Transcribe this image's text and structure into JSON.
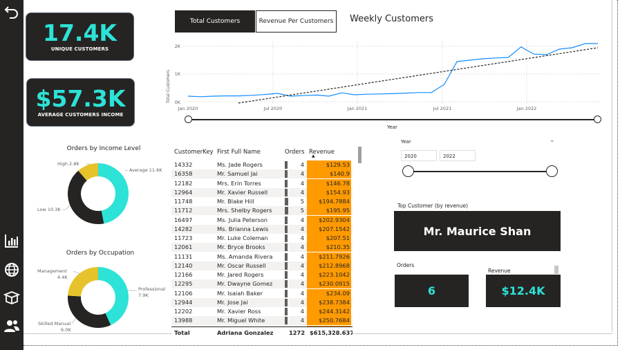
{
  "kpis": {
    "unique_customers": {
      "value": "17.4K",
      "label": "UNIQUE CUSTOMERS"
    },
    "avg_income": {
      "value": "$57.3K",
      "label": "AVERAGE CUSTOMERS INCOME"
    }
  },
  "tabs": {
    "total_customers": "Total Customers",
    "revenue_per_customer": "Revenue Per Customers"
  },
  "weekly": {
    "title": "Weekly Customers",
    "ylabel": "Total Customers",
    "xlabel": "Year",
    "yticks": [
      "2K",
      "1K",
      "0K"
    ],
    "xticks": [
      "Jan 2020",
      "Jul 2020",
      "Jan 2021",
      "Jul 2021",
      "Jan 2022"
    ]
  },
  "chart_data": [
    {
      "type": "line",
      "title": "Weekly Customers",
      "xlabel": "Year",
      "ylabel": "Total Customers",
      "x": [
        "2020-01",
        "2020-02",
        "2020-03",
        "2020-04",
        "2020-05",
        "2020-06",
        "2020-07",
        "2020-08",
        "2020-09",
        "2020-10",
        "2020-11",
        "2020-12",
        "2021-01",
        "2021-02",
        "2021-03",
        "2021-04",
        "2021-05",
        "2021-06",
        "2021-07",
        "2021-08",
        "2021-09",
        "2021-10",
        "2021-11",
        "2021-12",
        "2022-01",
        "2022-02",
        "2022-03",
        "2022-04",
        "2022-05",
        "2022-06"
      ],
      "series": [
        {
          "values": [
            200,
            180,
            200,
            210,
            210,
            230,
            260,
            300,
            200,
            220,
            240,
            200,
            320,
            250,
            270,
            280,
            290,
            310,
            330,
            330,
            620,
            1450,
            1500,
            1550,
            1580,
            1600,
            1980,
            1720,
            1700,
            1900,
            1950,
            2100,
            2100
          ]
        },
        {
          "values": [
            -50,
            30,
            110,
            190,
            270,
            350,
            430,
            510,
            590,
            670,
            750,
            830,
            910,
            990,
            1070,
            1150,
            1230,
            1310,
            1390,
            1470,
            1550,
            1630,
            1710,
            1790,
            1870,
            1950
          ]
        }
      ],
      "ylim": [
        0,
        2300
      ]
    },
    {
      "type": "pie",
      "title": "Orders by Income Level",
      "categories": [
        "Average",
        "Low",
        "High"
      ],
      "values": [
        11.6,
        10.3,
        2.8
      ],
      "labels": [
        "Average 11.6K",
        "Low 10.3K",
        "High 2.8K"
      ]
    },
    {
      "type": "pie",
      "title": "Orders by Occupation",
      "categories": [
        "Professional",
        "Skilled Manual",
        "Management"
      ],
      "values": [
        7.9,
        6.0,
        4.4
      ],
      "labels": [
        "Professional 7.9K",
        "Skilled Manual 6.0K",
        "Management 4.4K"
      ]
    }
  ],
  "donut_income": {
    "title": "Orders by Income Level",
    "avg": "Average 11.6K",
    "low": "Low 10.3K",
    "high": "High 2.8K"
  },
  "donut_occ": {
    "title": "Orders by Occupation",
    "prof_a": "Professional",
    "prof_b": "7.9K",
    "skill_a": "Skilled Manual",
    "skill_b": "6.0K",
    "mgmt_a": "Management",
    "mgmt_b": "4.4K"
  },
  "colors": {
    "teal": "#2de2d6",
    "dark": "#252423",
    "yellow": "#e6c22b",
    "orange": "#ff9a00"
  },
  "table": {
    "headers": [
      "CustomerKey",
      "First Full Name",
      "Orders",
      "Revenue"
    ],
    "rows": [
      [
        "14332",
        "Ms. Jade Rogers",
        "4",
        "$129.53"
      ],
      [
        "16358",
        "Mr. Samuel Jai",
        "4",
        "$140.9"
      ],
      [
        "12182",
        "Mrs. Erin Torres",
        "4",
        "$146.78"
      ],
      [
        "12964",
        "Mr. Xavier Russell",
        "4",
        "$154.93"
      ],
      [
        "11748",
        "Mr. Blake Hill",
        "5",
        "$194.7884"
      ],
      [
        "11712",
        "Mrs. Shelby Rogers",
        "5",
        "$195.95"
      ],
      [
        "16497",
        "Ms. Julia Peterson",
        "4",
        "$202.9304"
      ],
      [
        "14282",
        "Ms. Brianna Lewis",
        "4",
        "$207.1542"
      ],
      [
        "11723",
        "Mr. Luke Coleman",
        "4",
        "$207.51"
      ],
      [
        "12061",
        "Mr. Bryce Brooks",
        "4",
        "$210.35"
      ],
      [
        "11131",
        "Ms. Amanda Rivera",
        "4",
        "$211.7926"
      ],
      [
        "12140",
        "Mr. Oscar Russell",
        "4",
        "$212.8968"
      ],
      [
        "12166",
        "Mr. Jared Rogers",
        "4",
        "$223.1042"
      ],
      [
        "12295",
        "Mr. Dwayne Gomez",
        "4",
        "$230.0915"
      ],
      [
        "12106",
        "Mr. Isaiah Baker",
        "4",
        "$234.09"
      ],
      [
        "12944",
        "Mr. Jose Jai",
        "4",
        "$238.7384"
      ],
      [
        "12202",
        "Mr. Xavier Ross",
        "4",
        "$244.3142"
      ],
      [
        "13988",
        "Mr. Miguel White",
        "4",
        "$250.7684"
      ]
    ],
    "total": [
      "Total",
      "Adriana Gonzalez",
      "1272",
      "$615,328.637"
    ]
  },
  "year_slicer": {
    "label": "Year",
    "from": "2020",
    "to": "2022"
  },
  "top_customer": {
    "label": "Top Customer (by revenue)",
    "name": "Mr. Maurice Shan"
  },
  "orders_card": {
    "label": "Orders",
    "value": "6"
  },
  "revenue_card": {
    "label": "Revenue",
    "value": "$12.4K"
  },
  "icons": [
    "back-arrow-icon",
    "bar-chart-icon",
    "globe-icon",
    "box-icon",
    "users-icon"
  ]
}
